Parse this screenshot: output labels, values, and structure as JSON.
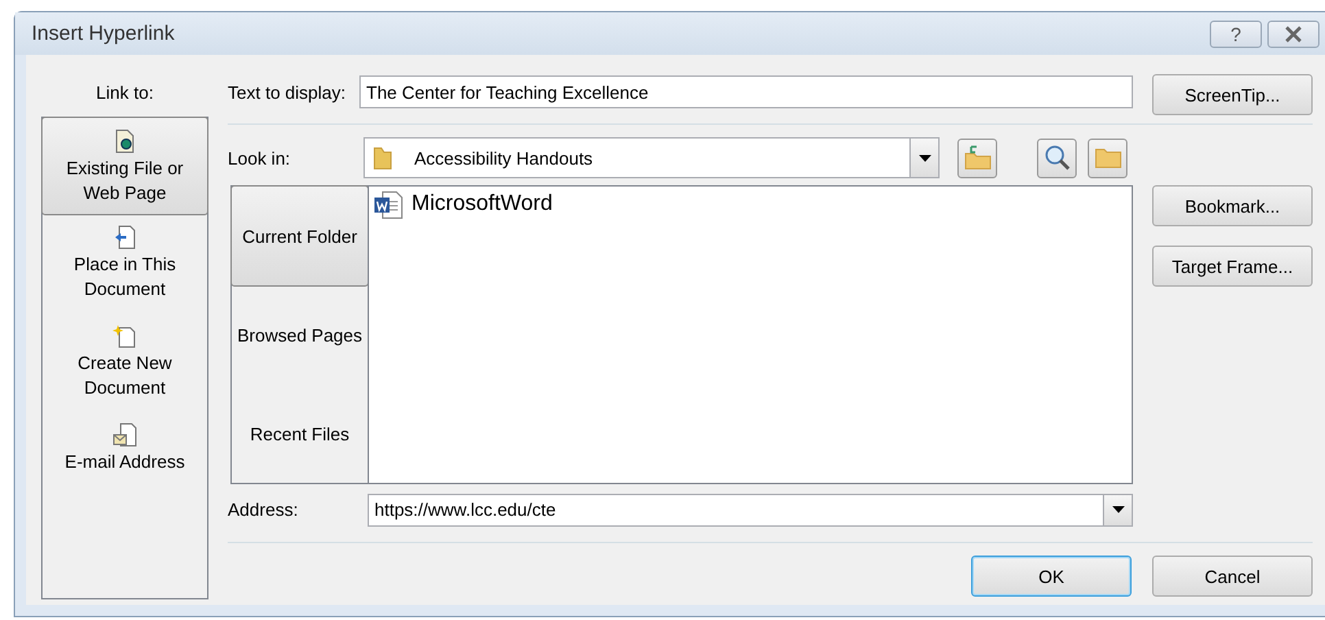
{
  "window": {
    "title": "Insert Hyperlink",
    "help": "?"
  },
  "link_to": {
    "label": "Link to:",
    "items": [
      {
        "kind": "file",
        "label": "Existing File or Web Page",
        "selected": true
      },
      {
        "kind": "place",
        "label": "Place in This Document",
        "selected": false
      },
      {
        "kind": "new",
        "label": "Create New Document",
        "selected": false
      },
      {
        "kind": "email",
        "label": "E-mail Address",
        "selected": false
      }
    ]
  },
  "text_to_display": {
    "label": "Text to display:",
    "value": "The Center for Teaching Excellence"
  },
  "look_in": {
    "label": "Look in:",
    "value": "Accessibility Handouts"
  },
  "browse_tabs": [
    {
      "label": "Current Folder",
      "selected": true
    },
    {
      "label": "Browsed Pages",
      "selected": false
    },
    {
      "label": "Recent Files",
      "selected": false
    }
  ],
  "files": [
    {
      "kind": "word",
      "name": "MicrosoftWord"
    }
  ],
  "address": {
    "label": "Address:",
    "value": "https://www.lcc.edu/cte"
  },
  "side_buttons": [
    "ScreenTip...",
    "Bookmark...",
    "Target Frame..."
  ],
  "footer_buttons": [
    {
      "label": "OK",
      "default": true
    },
    {
      "label": "Cancel",
      "default": false
    }
  ]
}
